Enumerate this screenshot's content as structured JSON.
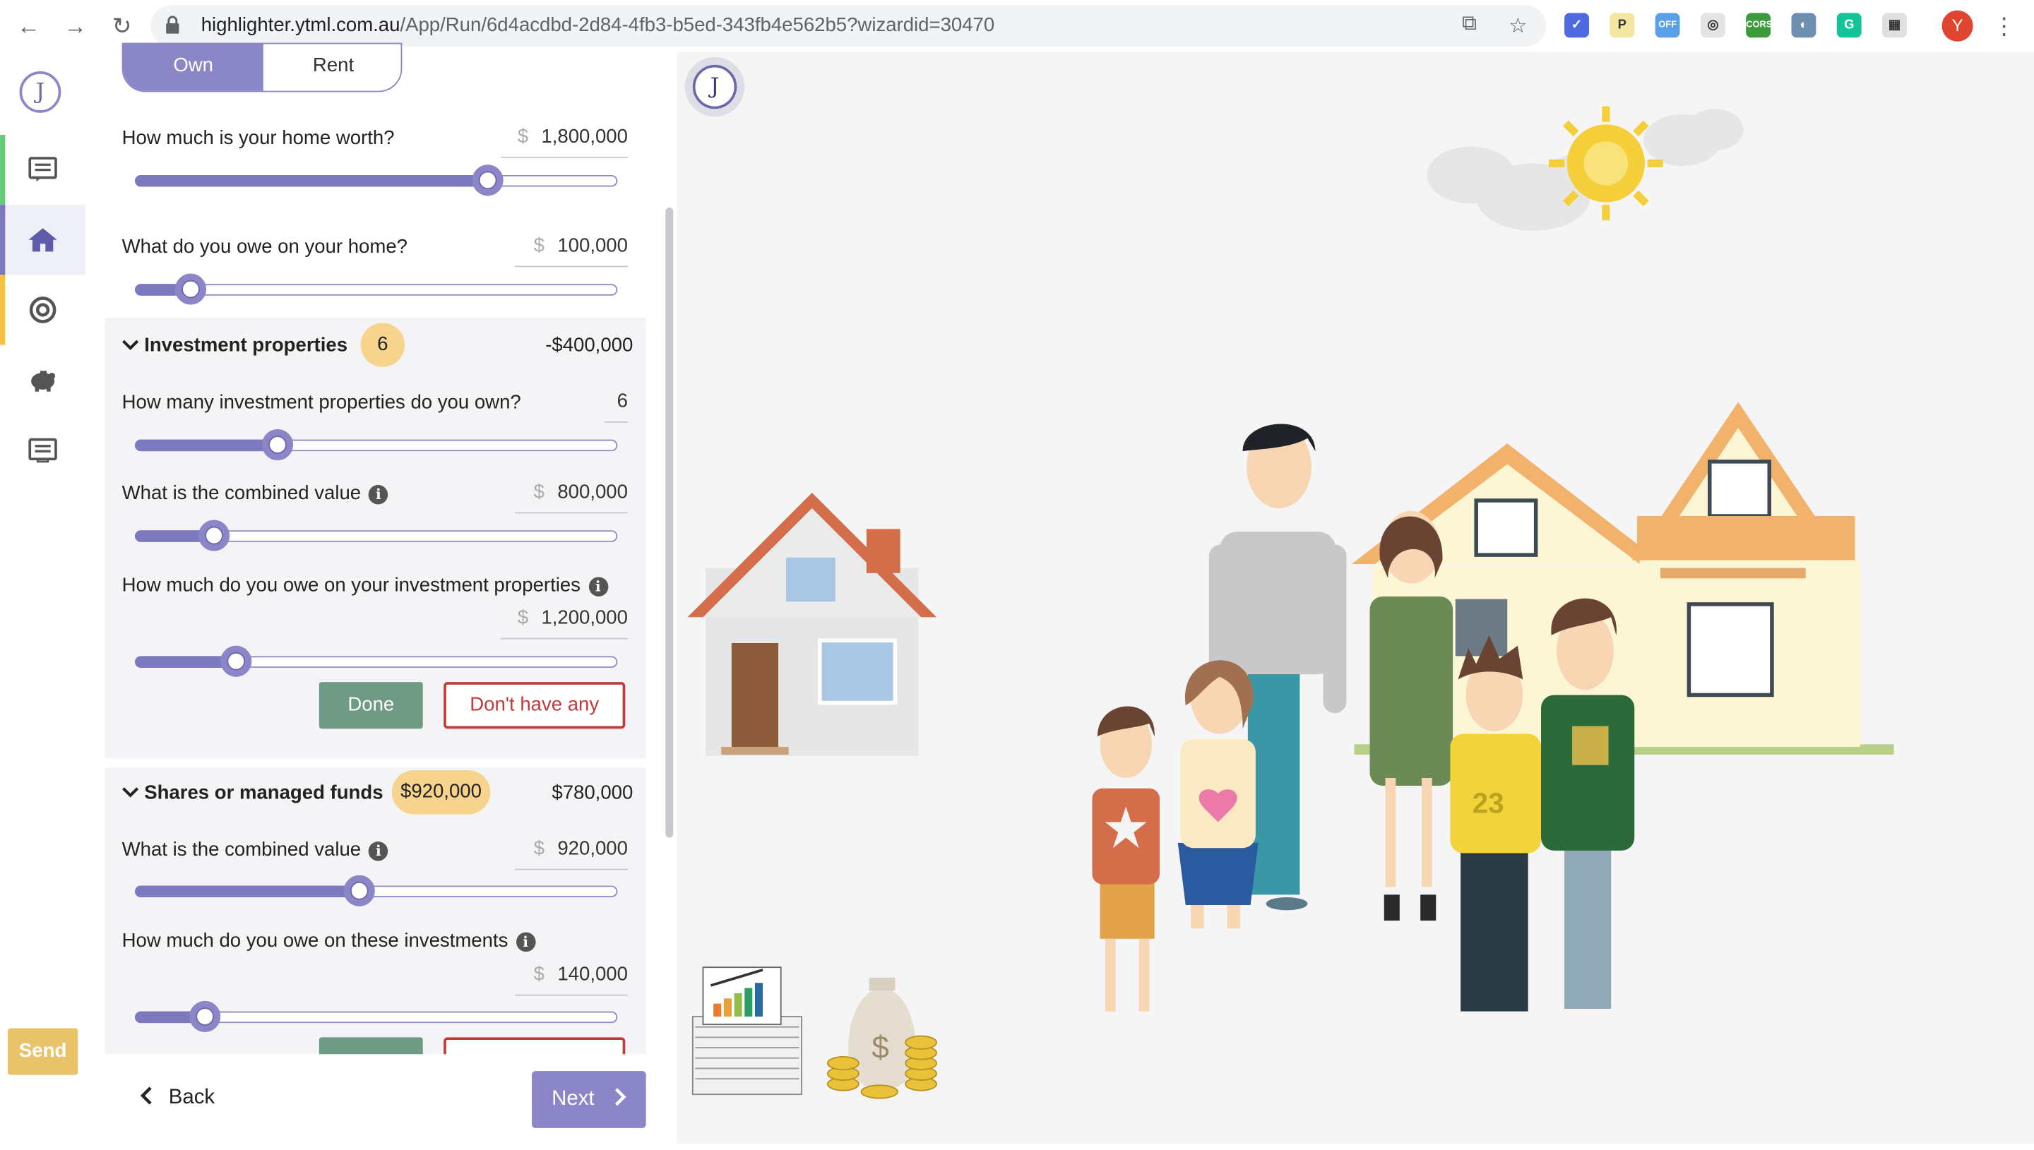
{
  "browser": {
    "url_host": "highlighter.ytml.com.au",
    "url_path": "/App/Run/6d4acdbd-2d84-4fb3-b5ed-343fb4e562b5?wizardid=30470",
    "profile_initial": "Y",
    "extensions": [
      {
        "icon": "check-badge-icon",
        "color": "#4f6ae0",
        "text": "✓"
      },
      {
        "icon": "p-extension-icon",
        "color": "#f3e6a0",
        "text": "P"
      },
      {
        "icon": "off-extension-icon",
        "color": "#5aa0e8",
        "text": "OFF"
      },
      {
        "icon": "circle-extension-icon",
        "color": "#e4e4e4",
        "text": "◎"
      },
      {
        "icon": "cors-extension-icon",
        "color": "#3b9b3b",
        "text": "CORS"
      },
      {
        "icon": "gauge-extension-icon",
        "color": "#6f8fb0",
        "text": "◐"
      },
      {
        "icon": "grammarly-icon",
        "color": "#15c39a",
        "text": "G"
      },
      {
        "icon": "grid-extension-icon",
        "color": "#e0e0e0",
        "text": "▦"
      }
    ]
  },
  "rail": {
    "logo": "J",
    "items": [
      {
        "name": "rail-item-messages",
        "icon": "chat-icon",
        "accent": "#66cc77"
      },
      {
        "name": "rail-item-home",
        "icon": "home-icon",
        "accent": "#7d79be"
      },
      {
        "name": "rail-item-goals",
        "icon": "target-icon",
        "accent": "#f5c242"
      },
      {
        "name": "rail-item-savings",
        "icon": "piggy-bank-icon",
        "accent": ""
      },
      {
        "name": "rail-item-notes",
        "icon": "list-icon",
        "accent": ""
      }
    ],
    "send_label": "Send"
  },
  "form": {
    "ownership": {
      "own": "Own",
      "rent": "Rent",
      "selected": "Own"
    },
    "home_worth": {
      "label": "How much is your home worth?",
      "currency": "$",
      "value": "1,800,000",
      "slider_fraction": 0.73
    },
    "home_owe": {
      "label": "What do you owe on your home?",
      "currency": "$",
      "value": "100,000",
      "slider_fraction": 0.115
    },
    "investment": {
      "title": "Investment properties",
      "badge": "6",
      "total": "-$400,000",
      "count": {
        "label": "How many investment properties do you own?",
        "value": "6",
        "slider_fraction": 0.295
      },
      "value": {
        "label": "What is the combined value",
        "currency": "$",
        "value": "800,000",
        "slider_fraction": 0.165
      },
      "owe": {
        "label": "How much do you owe on your investment properties",
        "currency": "$",
        "value": "1,200,000",
        "slider_fraction": 0.21
      },
      "done": "Done",
      "none": "Don't have any"
    },
    "shares": {
      "title": "Shares or managed funds",
      "badge": "$920,000",
      "total": "$780,000",
      "value": {
        "label": "What is the combined value",
        "currency": "$",
        "value": "920,000",
        "slider_fraction": 0.465
      },
      "owe": {
        "label": "How much do you owe on these investments",
        "currency": "$",
        "value": "140,000",
        "slider_fraction": 0.145
      }
    },
    "back": "Back",
    "next": "Next"
  },
  "scene": {
    "logo": "J",
    "shirt_number": "23",
    "money_symbol": "$"
  }
}
